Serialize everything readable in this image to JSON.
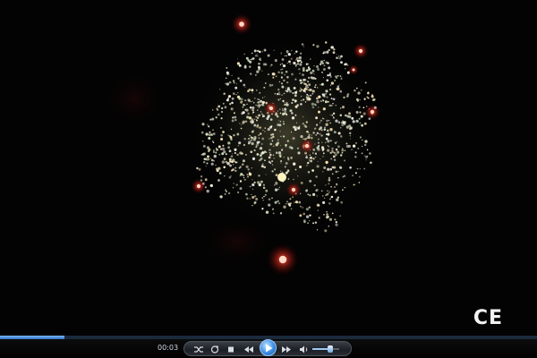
{
  "video": {
    "watermark_mark": "CE",
    "progress_fraction": 0.12
  },
  "controls": {
    "time_elapsed": "00:03",
    "volume_fraction": 0.65,
    "icons": [
      "shuffle-icon",
      "repeat-icon",
      "stop-icon",
      "previous-icon",
      "play-icon",
      "next-icon",
      "volume-icon"
    ]
  },
  "colors": {
    "accent": "#3a8de6",
    "sparks": "#f4ead0",
    "embers": "#ff3b24"
  }
}
